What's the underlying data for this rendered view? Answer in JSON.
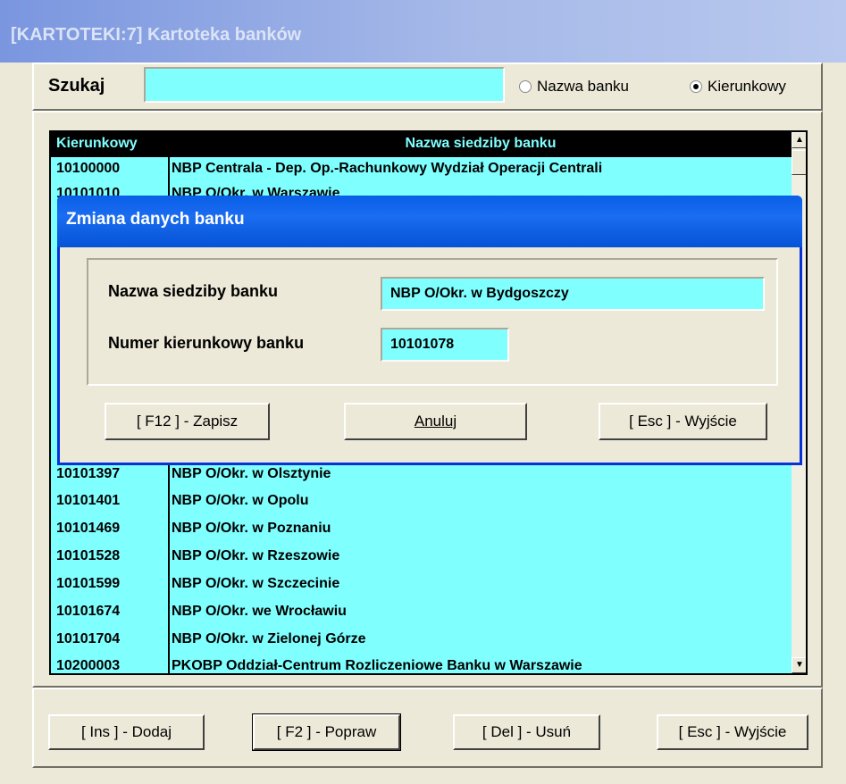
{
  "window": {
    "title": "[KARTOTEKI:7]  Kartoteka banków"
  },
  "search": {
    "label": "Szukaj",
    "value": "",
    "radio_options": [
      {
        "label": "Nazwa banku",
        "selected": false
      },
      {
        "label": "Kierunkowy",
        "selected": true
      }
    ]
  },
  "table": {
    "columns": [
      "Kierunkowy",
      "Nazwa siedziby banku"
    ],
    "rows": [
      {
        "code": "10100000",
        "name": "NBP Centrala - Dep. Op.-Rachunkowy Wydział Operacji Centrali"
      },
      {
        "code": "10101010",
        "name": "NBP O/Okr. w Warszawie"
      },
      {
        "code": "10101397",
        "name": "NBP O/Okr. w Olsztynie"
      },
      {
        "code": "10101401",
        "name": "NBP O/Okr. w Opolu"
      },
      {
        "code": "10101469",
        "name": "NBP O/Okr. w Poznaniu"
      },
      {
        "code": "10101528",
        "name": "NBP O/Okr. w Rzeszowie"
      },
      {
        "code": "10101599",
        "name": "NBP O/Okr. w Szczecinie"
      },
      {
        "code": "10101674",
        "name": "NBP O/Okr. we Wrocławiu"
      },
      {
        "code": "10101704",
        "name": "NBP O/Okr. w Zielonej Górze"
      },
      {
        "code": "10200003",
        "name": "PKOBP Oddział-Centrum Rozliczeniowe Banku w Warszawie"
      }
    ]
  },
  "buttons": {
    "add": "[ Ins ] - Dodaj",
    "edit": "[ F2 ] - Popraw",
    "delete": "[ Del ] - Usuń",
    "exit": "[ Esc ] - Wyjście"
  },
  "dialog": {
    "title": "Zmiana danych banku",
    "name_label": "Nazwa siedziby banku",
    "name_value": "NBP O/Okr. w Bydgoszczy",
    "code_label": "Numer kierunkowy banku",
    "code_value": "10101078",
    "save": "[ F12 ] - Zapisz",
    "cancel": "Anuluj",
    "exit": "[ Esc ] - Wyjście"
  },
  "colors": {
    "field_bg": "#80ffff",
    "dialog_title": "#0a5fe8",
    "window_bg": "#ece9d8"
  }
}
